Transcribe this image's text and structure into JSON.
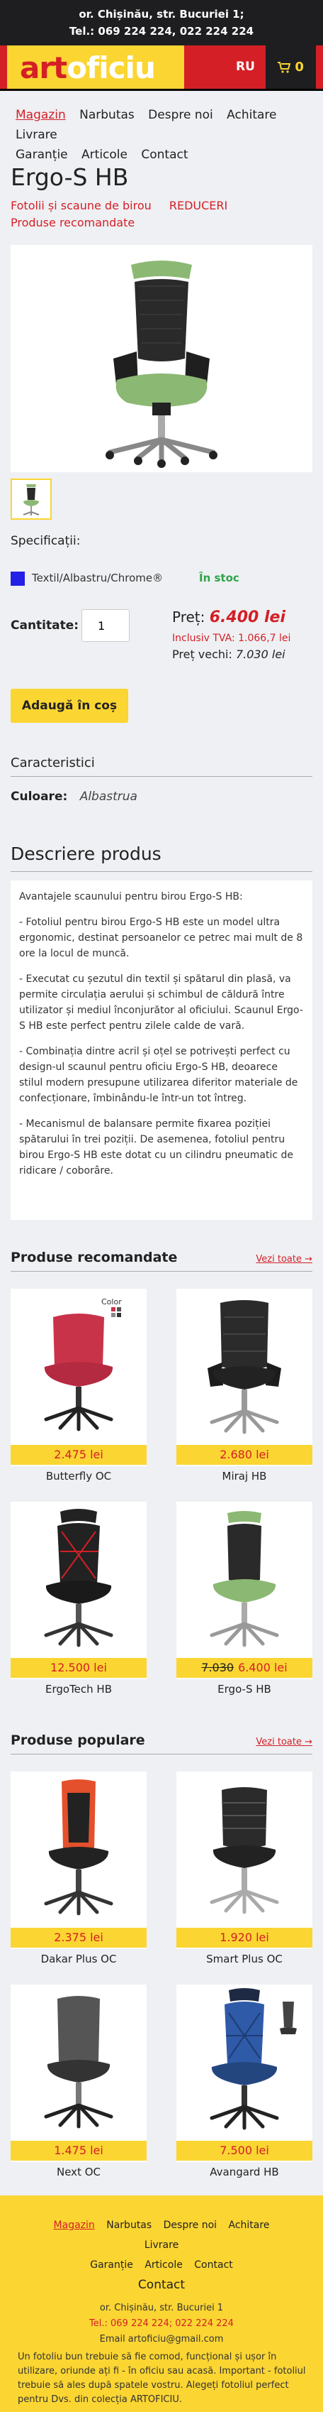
{
  "topbar": {
    "address": "or. Chișinău, str. Bucuriei 1;",
    "phones": "Tel.: 069 224 224, 022 224 224"
  },
  "header": {
    "logo_part1": "art",
    "logo_part2": "oficiu",
    "lang": "RU",
    "cart_count": "0"
  },
  "nav": [
    "Magazin",
    "Narbutas",
    "Despre noi",
    "Achitare",
    "Livrare",
    "Garanție",
    "Articole",
    "Contact"
  ],
  "product": {
    "title": "Ergo-S HB",
    "categories": [
      "Fotolii și scaune de birou",
      "REDUCERI",
      "Produse recomandate"
    ],
    "spec_label": "Specificații:",
    "variant_color": "#2420e6",
    "variant_name": "Textil/Albastru/Chrome®",
    "stock": "În stoc",
    "qty_label": "Cantitate:",
    "qty_value": "1",
    "price_label": "Preț:",
    "price": "6.400 lei",
    "vat": "Inclusiv TVA: 1.066,7 lei",
    "old_price_label": "Preț vechi:",
    "old_price": "7.030 lei",
    "add_to_cart": "Adaugă în coș"
  },
  "characteristics": {
    "heading": "Caracteristici",
    "label": "Culoare:",
    "value": "Albastrua"
  },
  "description": {
    "heading": "Descriere produs",
    "paragraphs": [
      "Avantajele scaunului pentru birou Ergo-S HB:",
      "- Fotoliul pentru birou Ergo-S HB este un model ultra ergonomic, destinat persoanelor ce petrec mai mult de 8 ore la locul de muncă.",
      "- Executat cu șezutul din textil și spătarul din plasă, va permite circulația aerului și schimbul de căldură între utilizator și mediul înconjurător al oficiului. Scaunul Ergo-S HB este perfect pentru zilele calde de vară.",
      "- Combinația dintre acril și oțel se potrivești perfect cu design-ul scaunul pentru oficiu Ergo-S HB, deoarece stilul modern presupune utilizarea diferitor materiale de confecționare, îmbinându-le într-un tot întreg.",
      "- Mecanismul de balansare permite fixarea poziției spătarului în trei poziții. De asemenea, fotoliul pentru birou Ergo-S HB este dotat cu un cilindru pneumatic de ridicare / coborâre."
    ]
  },
  "recommended": {
    "heading": "Produse recomandate",
    "see_all": "Vezi toate →",
    "items": [
      {
        "name": "Butterfly OC",
        "price": "2.475 lei",
        "old_price": "",
        "badge": "Color",
        "color": "#c9334a"
      },
      {
        "name": "Miraj HB",
        "price": "2.680 lei",
        "old_price": "",
        "badge": "",
        "color": "#2b2b2b"
      },
      {
        "name": "ErgoTech HB",
        "price": "12.500 lei",
        "old_price": "",
        "badge": "",
        "color": "#222222"
      },
      {
        "name": "Ergo-S HB",
        "price": "6.400 lei",
        "old_price": "7.030",
        "badge": "",
        "color": "#8bb873"
      }
    ]
  },
  "popular": {
    "heading": "Produse populare",
    "see_all": "Vezi toate →",
    "items": [
      {
        "name": "Dakar Plus OC",
        "price": "2.375 lei",
        "color": "#e4502b"
      },
      {
        "name": "Smart Plus OC",
        "price": "1.920 lei",
        "color": "#2b2b2b"
      },
      {
        "name": "Next OC",
        "price": "1.475 lei",
        "color": "#555555"
      },
      {
        "name": "Avangard HB",
        "price": "7.500 lei",
        "color": "#2f5aa8"
      }
    ]
  },
  "footer": {
    "nav": [
      "Magazin",
      "Narbutas",
      "Despre noi",
      "Achitare",
      "Livrare",
      "Garanție",
      "Articole",
      "Contact"
    ],
    "contact_title": "Contact",
    "address": "or. Chișinău, str. Bucuriei 1",
    "phones": "Tel.: 069 224 224; 022 224 224",
    "email": "Email artoficiu@gmail.com",
    "note": "Un fotoliu bun trebuie să fie comod, funcțional și ușor în utilizare, oriunde ați fi - în oficiu sau acasă. Important - fotoliul trebuie să ales după spatele vostru. Alegeți fotoliul perfect pentru Dvs. din colecția ARTOFICIU."
  }
}
